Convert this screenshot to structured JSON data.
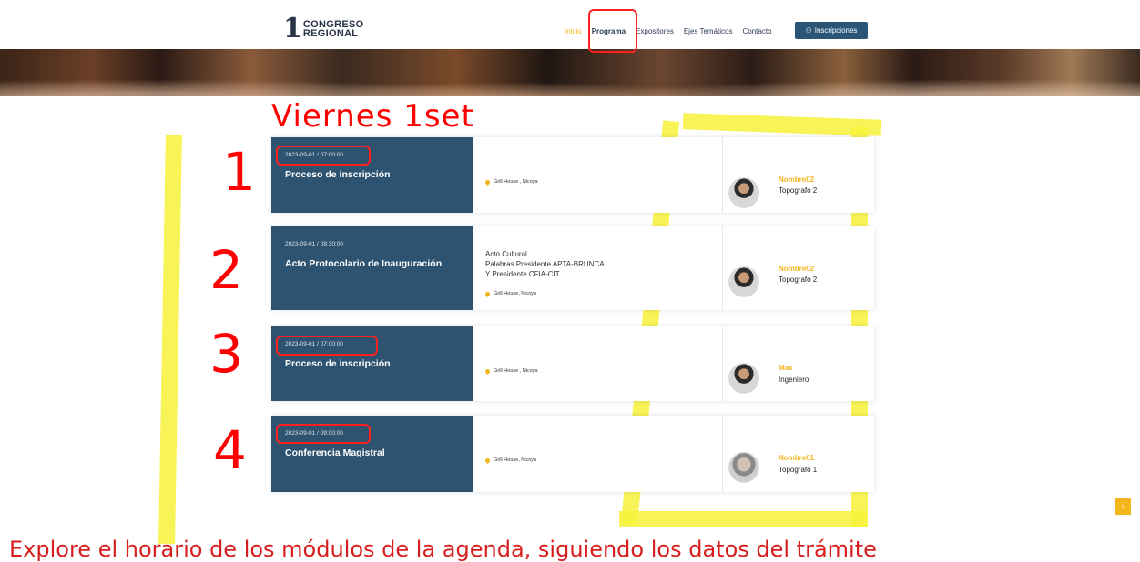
{
  "header": {
    "logo": {
      "digit": "1",
      "line1": "CONGRESO",
      "line2": "REGIONAL"
    },
    "nav": [
      {
        "label": "Inicio",
        "active": true
      },
      {
        "label": "Programa",
        "active": false
      },
      {
        "label": "Expositores",
        "active": false
      },
      {
        "label": "Ejes Temáticos",
        "active": false
      },
      {
        "label": "Contacto",
        "active": false
      }
    ],
    "cta_label": "Inscripciones"
  },
  "annotation": {
    "day_title": "Viernes 1set",
    "numbers": [
      "1",
      "2",
      "3",
      "4"
    ],
    "footer_note": "Explore el horario de los módulos de la agenda, siguiendo los datos del trámite"
  },
  "schedule": [
    {
      "time": "2023-09-01 / 07:00:00",
      "title": "Proceso de inscripción",
      "description": [],
      "location": "Grill House , Nicoya",
      "speaker_name": "Nombre02",
      "speaker_role": "Topografo 2"
    },
    {
      "time": "2023-09-01 / 08:30:00",
      "title": "Acto Protocolario de Inauguración",
      "description": [
        "Acto Cultural",
        "Palabras Presidente APTA-BRUNCA",
        "Y Presidente CFIA-CIT"
      ],
      "location": "Grill House, Nicoya",
      "speaker_name": "Nombre02",
      "speaker_role": "Topografo 2"
    },
    {
      "time": "2023-09-01 / 07:00:00",
      "title": "Proceso de inscripción",
      "description": [],
      "location": "Grill House , Nicoya",
      "speaker_name": "Max",
      "speaker_role": "Ingeniero"
    },
    {
      "time": "2023-09-01 / 09:00:00",
      "title": "Conferencia Magistral",
      "description": [],
      "location": "Grill House, Nicoya",
      "speaker_name": "Nombre01",
      "speaker_role": "Topografo 1"
    }
  ],
  "scroll_top_icon": "arrow-up-icon"
}
